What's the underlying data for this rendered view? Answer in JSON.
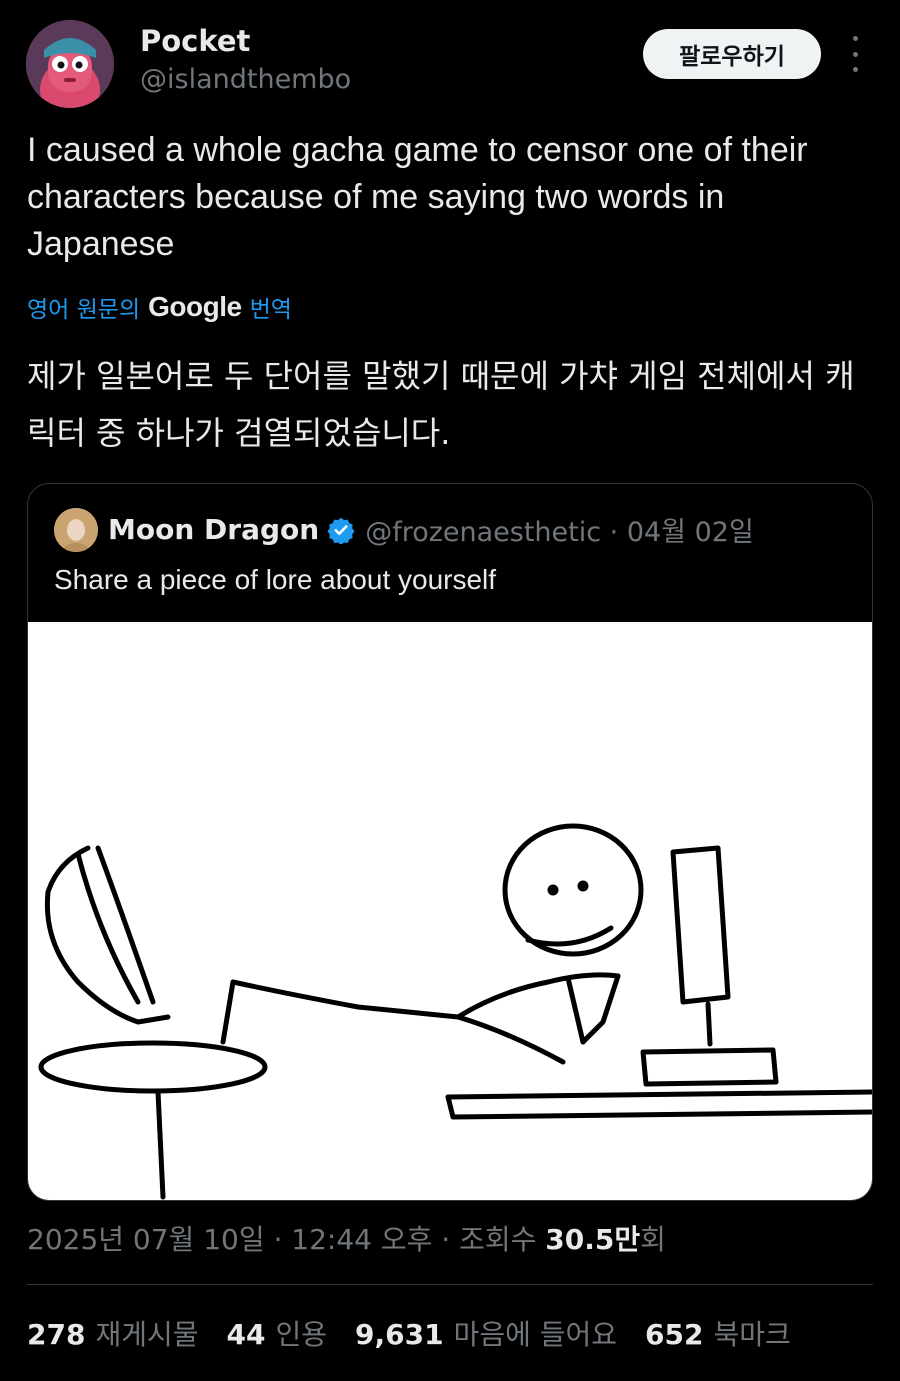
{
  "author": {
    "name": "Pocket",
    "handle": "@islandthembo",
    "follow_label": "팔로우하기"
  },
  "tweet": {
    "text": "I caused a whole gacha game to censor one of their characters because of me saying two words in Japanese",
    "translate_prefix": "영어 원문의",
    "translate_brand": "Google",
    "translate_suffix": "번역",
    "translated_text": "제가 일본어로 두 단어를 말했기 때문에 가챠 게임 전체에서 캐릭터 중 하나가 검열되었습니다."
  },
  "quote": {
    "name": "Moon Dragon",
    "handle_date": "@frozenaesthetic · 04월 02일",
    "text": "Share a piece of lore about yourself",
    "image_description_icon": "stick-figure-at-computer"
  },
  "meta": {
    "date": "2025년 07월 10일 · 12:44 오후 · 조회수 ",
    "views": "30.5만",
    "views_suffix": "회"
  },
  "stats": [
    {
      "num": "278",
      "label": "재게시물"
    },
    {
      "num": "44",
      "label": "인용"
    },
    {
      "num": "9,631",
      "label": "마음에 들어요"
    },
    {
      "num": "652",
      "label": "북마크"
    }
  ],
  "colors": {
    "background": "#000000",
    "accent": "#1d9bf0",
    "secondary_text": "#71767b"
  }
}
